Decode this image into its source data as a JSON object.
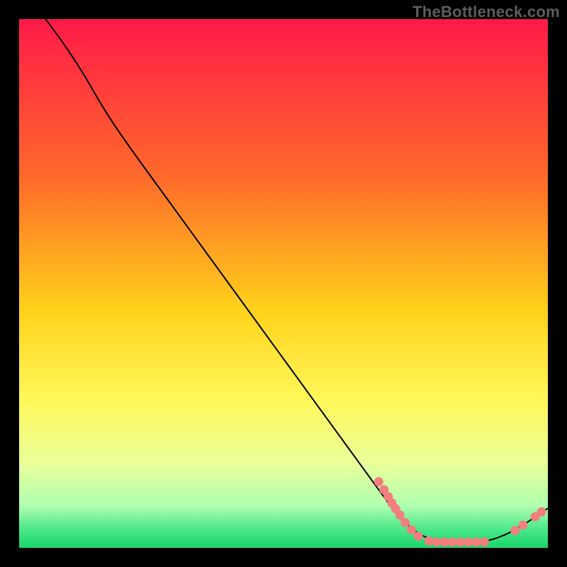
{
  "watermark": "TheBottleneck.com",
  "chart_data": {
    "type": "line",
    "title": "",
    "xlabel": "",
    "ylabel": "",
    "xlim": [
      0,
      100
    ],
    "ylim": [
      0,
      100
    ],
    "gradient_stops": [
      {
        "offset": 0,
        "color": "#ff1a49"
      },
      {
        "offset": 0.3,
        "color": "#ff6a2a"
      },
      {
        "offset": 0.55,
        "color": "#ffd21a"
      },
      {
        "offset": 0.72,
        "color": "#fff85a"
      },
      {
        "offset": 0.84,
        "color": "#eaff99"
      },
      {
        "offset": 0.92,
        "color": "#b0ffb0"
      },
      {
        "offset": 0.965,
        "color": "#4be889"
      },
      {
        "offset": 1.0,
        "color": "#18d66a"
      }
    ],
    "curve": [
      {
        "x": 5,
        "y": 100
      },
      {
        "x": 8,
        "y": 96
      },
      {
        "x": 12,
        "y": 90
      },
      {
        "x": 16,
        "y": 83
      },
      {
        "x": 20,
        "y": 77
      },
      {
        "x": 28,
        "y": 66
      },
      {
        "x": 36,
        "y": 55
      },
      {
        "x": 44,
        "y": 44
      },
      {
        "x": 52,
        "y": 33
      },
      {
        "x": 60,
        "y": 22
      },
      {
        "x": 68,
        "y": 11
      },
      {
        "x": 72,
        "y": 5.5
      },
      {
        "x": 76,
        "y": 2.2
      },
      {
        "x": 80,
        "y": 1.1
      },
      {
        "x": 84,
        "y": 1.1
      },
      {
        "x": 88,
        "y": 1.1
      },
      {
        "x": 92,
        "y": 2.4
      },
      {
        "x": 96,
        "y": 4.7
      },
      {
        "x": 100,
        "y": 7.5
      }
    ],
    "scatter": [
      {
        "x": 68.0,
        "y": 12.5
      },
      {
        "x": 69.0,
        "y": 11.0
      },
      {
        "x": 69.8,
        "y": 9.7
      },
      {
        "x": 70.5,
        "y": 8.5
      },
      {
        "x": 71.2,
        "y": 7.4
      },
      {
        "x": 72.0,
        "y": 6.2
      },
      {
        "x": 73.0,
        "y": 4.8
      },
      {
        "x": 74.2,
        "y": 3.4
      },
      {
        "x": 75.5,
        "y": 2.2
      },
      {
        "x": 77.5,
        "y": 1.3
      },
      {
        "x": 79.0,
        "y": 1.1
      },
      {
        "x": 80.5,
        "y": 1.1
      },
      {
        "x": 82.0,
        "y": 1.1
      },
      {
        "x": 83.5,
        "y": 1.1
      },
      {
        "x": 85.0,
        "y": 1.1
      },
      {
        "x": 86.5,
        "y": 1.1
      },
      {
        "x": 88.0,
        "y": 1.1
      },
      {
        "x": 93.8,
        "y": 3.3
      },
      {
        "x": 95.3,
        "y": 4.3
      },
      {
        "x": 97.6,
        "y": 5.9
      },
      {
        "x": 98.8,
        "y": 6.8
      }
    ],
    "scatter_color": "#f37e7e",
    "line_color": "#000000"
  }
}
